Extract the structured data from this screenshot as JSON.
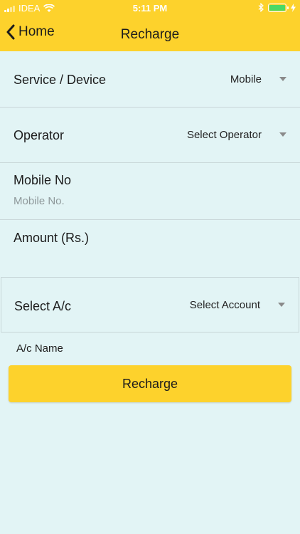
{
  "status_bar": {
    "carrier": "IDEA",
    "time": "5:11 PM",
    "icons": [
      "signal-icon",
      "wifi-icon",
      "bluetooth-icon",
      "battery-icon",
      "charging-icon"
    ]
  },
  "nav": {
    "back_label": "Home",
    "title": "Recharge"
  },
  "form": {
    "service": {
      "label": "Service / Device",
      "value": "Mobile"
    },
    "operator": {
      "label": "Operator",
      "value": "Select Operator"
    },
    "mobile": {
      "label": "Mobile No",
      "placeholder": "Mobile No."
    },
    "amount": {
      "label": "Amount (Rs.)"
    },
    "account": {
      "label": "Select A/c",
      "value": "Select Account"
    },
    "account_name_label": "A/c Name"
  },
  "actions": {
    "recharge_label": "Recharge"
  },
  "colors": {
    "accent": "#fdd22c",
    "background": "#e2f4f5",
    "battery": "#4cd964"
  }
}
